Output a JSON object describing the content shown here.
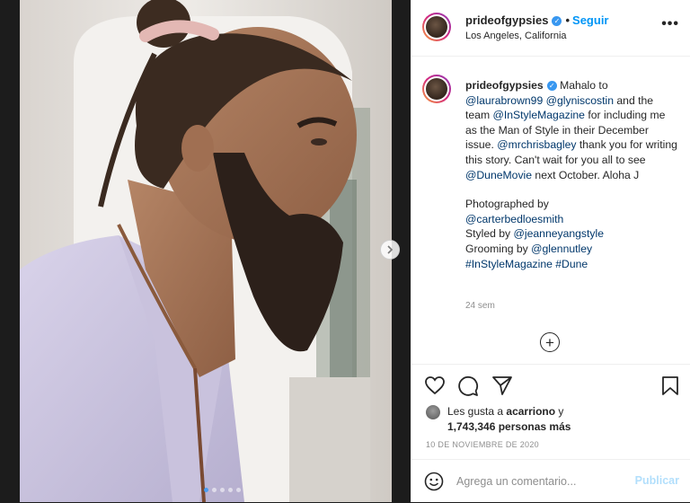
{
  "post": {
    "username": "prideofgypsies",
    "follow_label": "Seguir",
    "separator": "•",
    "location": "Los Angeles, California",
    "more_label": "•••"
  },
  "caption": {
    "username": "prideofgypsies",
    "t1": " Mahalo to ",
    "m1": "@laurabrown99",
    "t2": " ",
    "m2": "@glyniscostin",
    "t3": " and the team ",
    "m3": "@InStyleMagazine",
    "t4": " for including me as the Man of Style in their December issue. ",
    "m4": "@mrchrisbagley",
    "t5": " thank you for writing this story. Can't wait for you all to see ",
    "m5": "@DuneMovie",
    "t6": " next October.  Aloha J",
    "photo_label": "Photographed by",
    "photo_mention": "@carterbedloesmith",
    "styled_label": "Styled by ",
    "styled_mention": "@jeanneyangstyle",
    "grooming_label": "Grooming by ",
    "grooming_mention": "@glennutley",
    "tag1": "#InStyleMagazine",
    "tag2": "#Dune"
  },
  "time_ago": "24 sem",
  "load_more_icon": "plus-circle-icon",
  "likes": {
    "prefix": "Les gusta a ",
    "user": "acarriono",
    "middle": " y",
    "count": "1,743,346 personas más"
  },
  "date": "10 DE NOVIEMBRE DE 2020",
  "comment": {
    "placeholder": "Agrega un comentario...",
    "publish_label": "Publicar"
  },
  "carousel": {
    "slides": 5,
    "active_index": 0
  },
  "icons": [
    "verified-badge-icon",
    "heart-icon",
    "comment-icon",
    "share-icon",
    "bookmark-icon",
    "emoji-icon",
    "chevron-right-icon"
  ],
  "colors": {
    "accent": "#0095f6",
    "mention": "#00376b",
    "muted": "#8e8e8e",
    "publish_disabled": "#b2dffc"
  }
}
